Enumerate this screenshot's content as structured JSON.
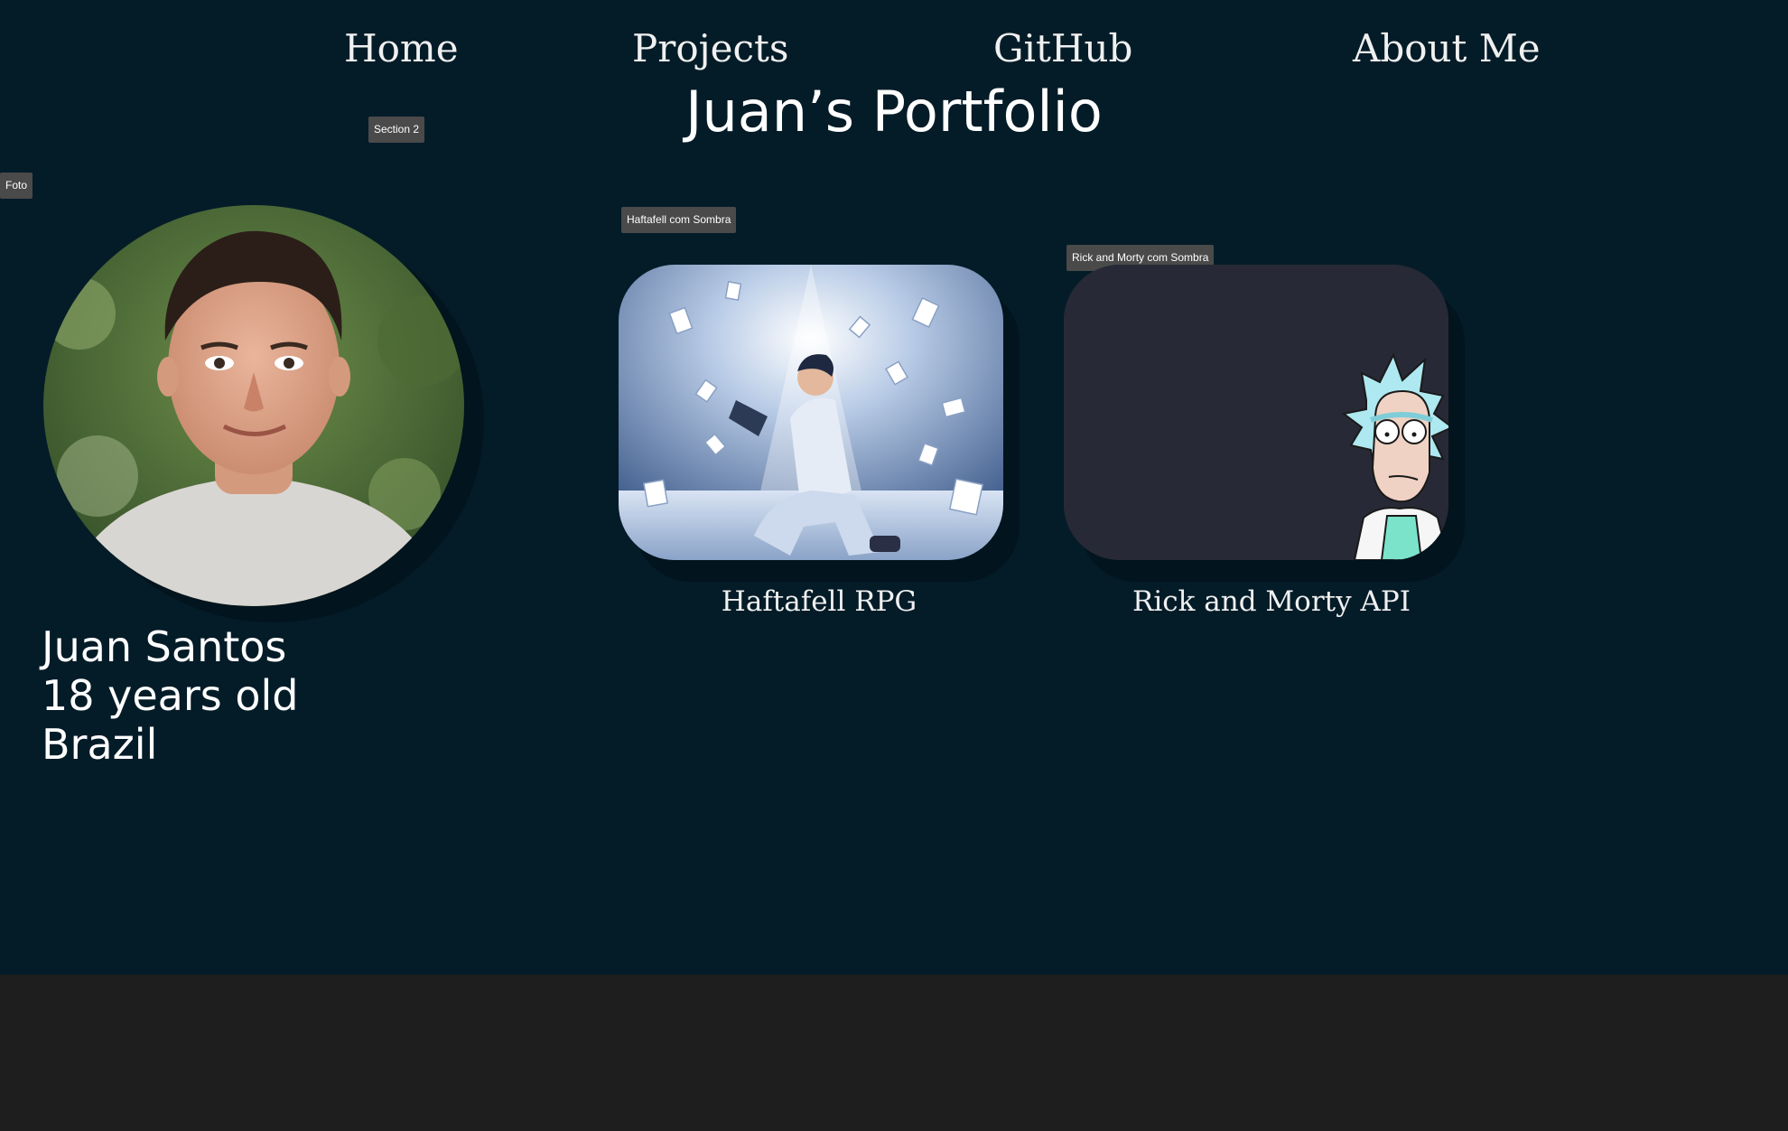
{
  "nav": {
    "home": "Home",
    "projects": "Projects",
    "github": "GitHub",
    "about": "About Me"
  },
  "page_title": "Juan’s Portfolio",
  "canvas_tags": {
    "section": "Section 2",
    "photo": "Foto",
    "haftafell_shadow": "Haftafell com Sombra",
    "rick_shadow": "Rick and Morty com Sombra"
  },
  "profile": {
    "name": "Juan Santos",
    "age": "18 years old",
    "country": "Brazil"
  },
  "projects": [
    {
      "title": "Haftafell RPG"
    },
    {
      "title": "Rick and Morty API"
    }
  ],
  "colors": {
    "background": "#041c28",
    "shadow": "#02141d",
    "canvas_outside": "#1e1e1e",
    "rick_card": "#272a36",
    "tag_bg": "#4a4a4a"
  }
}
